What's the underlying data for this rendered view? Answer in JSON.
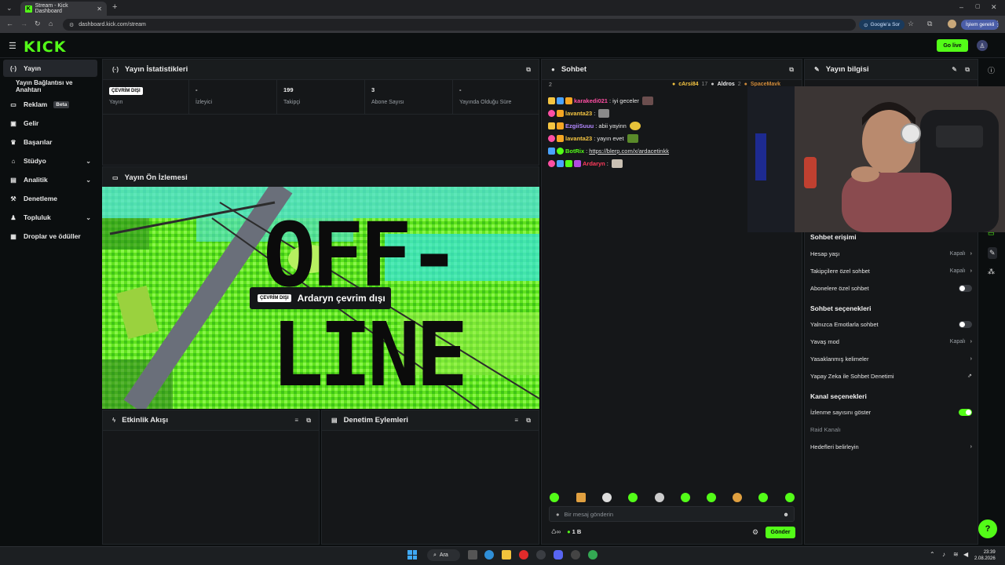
{
  "browser": {
    "tab_title": "Stream - Kick Dashboard",
    "url": "dashboard.kick.com/stream",
    "google_btn": "Google'a Sor",
    "profile_label": "İşlem gerekli"
  },
  "topbar": {
    "logo": "KICK",
    "go_live": "Go live"
  },
  "sidebar": {
    "items": [
      {
        "label": "Yayın",
        "icon": "broadcast-icon"
      },
      {
        "label": "Yayın Bağlantısı ve Anahtarı"
      },
      {
        "label": "Reklam",
        "badge": "Beta",
        "icon": "tv-icon"
      },
      {
        "label": "Gelir",
        "icon": "money-icon"
      },
      {
        "label": "Başarılar",
        "icon": "trophy-icon"
      },
      {
        "label": "Stüdyo",
        "icon": "studio-icon"
      },
      {
        "label": "Analitik",
        "icon": "chart-icon"
      },
      {
        "label": "Denetleme",
        "icon": "hammer-icon"
      },
      {
        "label": "Topluluk",
        "icon": "community-icon"
      },
      {
        "label": "Droplar ve ödüller",
        "icon": "gift-icon"
      }
    ]
  },
  "stats": {
    "title": "Yayın İstatistikleri",
    "badge": "ÇEVRİM DIŞI",
    "cells": [
      {
        "value": "",
        "label": "Yayın"
      },
      {
        "value": "-",
        "label": "İzleyici"
      },
      {
        "value": "199",
        "label": "Takipçi"
      },
      {
        "value": "3",
        "label": "Abone Sayısı"
      },
      {
        "value": "-",
        "label": "Yayında Olduğu Süre"
      }
    ]
  },
  "preview": {
    "title": "Yayın Ön İzlemesi",
    "badge": "ÇEVRİM DIŞI",
    "status": "Ardaryn çevrim dışı",
    "art_line1": "OFF-",
    "art_line2": "LINE"
  },
  "events": {
    "title": "Etkinlik Akışı"
  },
  "moderation": {
    "title": "Denetim Eylemleri"
  },
  "chat": {
    "title": "Sohbet",
    "viewer_count": "2",
    "top": [
      {
        "name": "cArsi84",
        "count": "17"
      },
      {
        "name": "Aldros",
        "count": "2"
      },
      {
        "name": "SpaceMavk"
      }
    ],
    "messages": [
      {
        "user": "karakedi021",
        "color": "#ff4fa3",
        "text": ": iyi geceler"
      },
      {
        "user": "lavanta23",
        "color": "#f5c542",
        "text": ":"
      },
      {
        "user": "EzgiiSuuu",
        "color": "#b388ff",
        "text": ": abii yayinn"
      },
      {
        "user": "lavanta23",
        "color": "#f5c542",
        "text": ": yayın evet"
      },
      {
        "user": "BotRix",
        "color": "#53fc18",
        "text": ": ",
        "link": "https://blerp.com/x/ardacetinkk"
      },
      {
        "user": "Ardaryn",
        "color": "#ff3b5c",
        "text": ":"
      }
    ],
    "input_placeholder": "Bir mesaj gönderin",
    "send": "Gönder",
    "points": "1 B"
  },
  "info": {
    "title": "Yayın bilgisi",
    "access_title": "Sohbet erişimi",
    "options_title": "Sohbet seçenekleri",
    "channel_title": "Kanal seçenekleri",
    "rows": {
      "age": {
        "label": "Hesap yaşı",
        "value": "Kapalı"
      },
      "followers": {
        "label": "Takipçilere özel sohbet",
        "value": "Kapalı"
      },
      "subs": {
        "label": "Abonelere özel sohbet"
      },
      "emotes": {
        "label": "Yalnızca Emotlarla sohbet"
      },
      "slow": {
        "label": "Yavaş mod",
        "value": "Kapalı"
      },
      "banned": {
        "label": "Yasaklanmış kelimeler"
      },
      "ai": {
        "label": "Yapay Zeka ile Sohbet Denetimi"
      },
      "viewcount": {
        "label": "İzlenme sayısını göster"
      },
      "raid": {
        "label": "Raid Kanalı"
      },
      "goals": {
        "label": "Hedefleri belirleyin"
      }
    }
  },
  "taskbar": {
    "search": "Ara",
    "time": "23:39",
    "date": "2.08.2026"
  },
  "colors": {
    "accent": "#53fc18",
    "bg": "#0b0e0f",
    "panel": "#151719"
  }
}
